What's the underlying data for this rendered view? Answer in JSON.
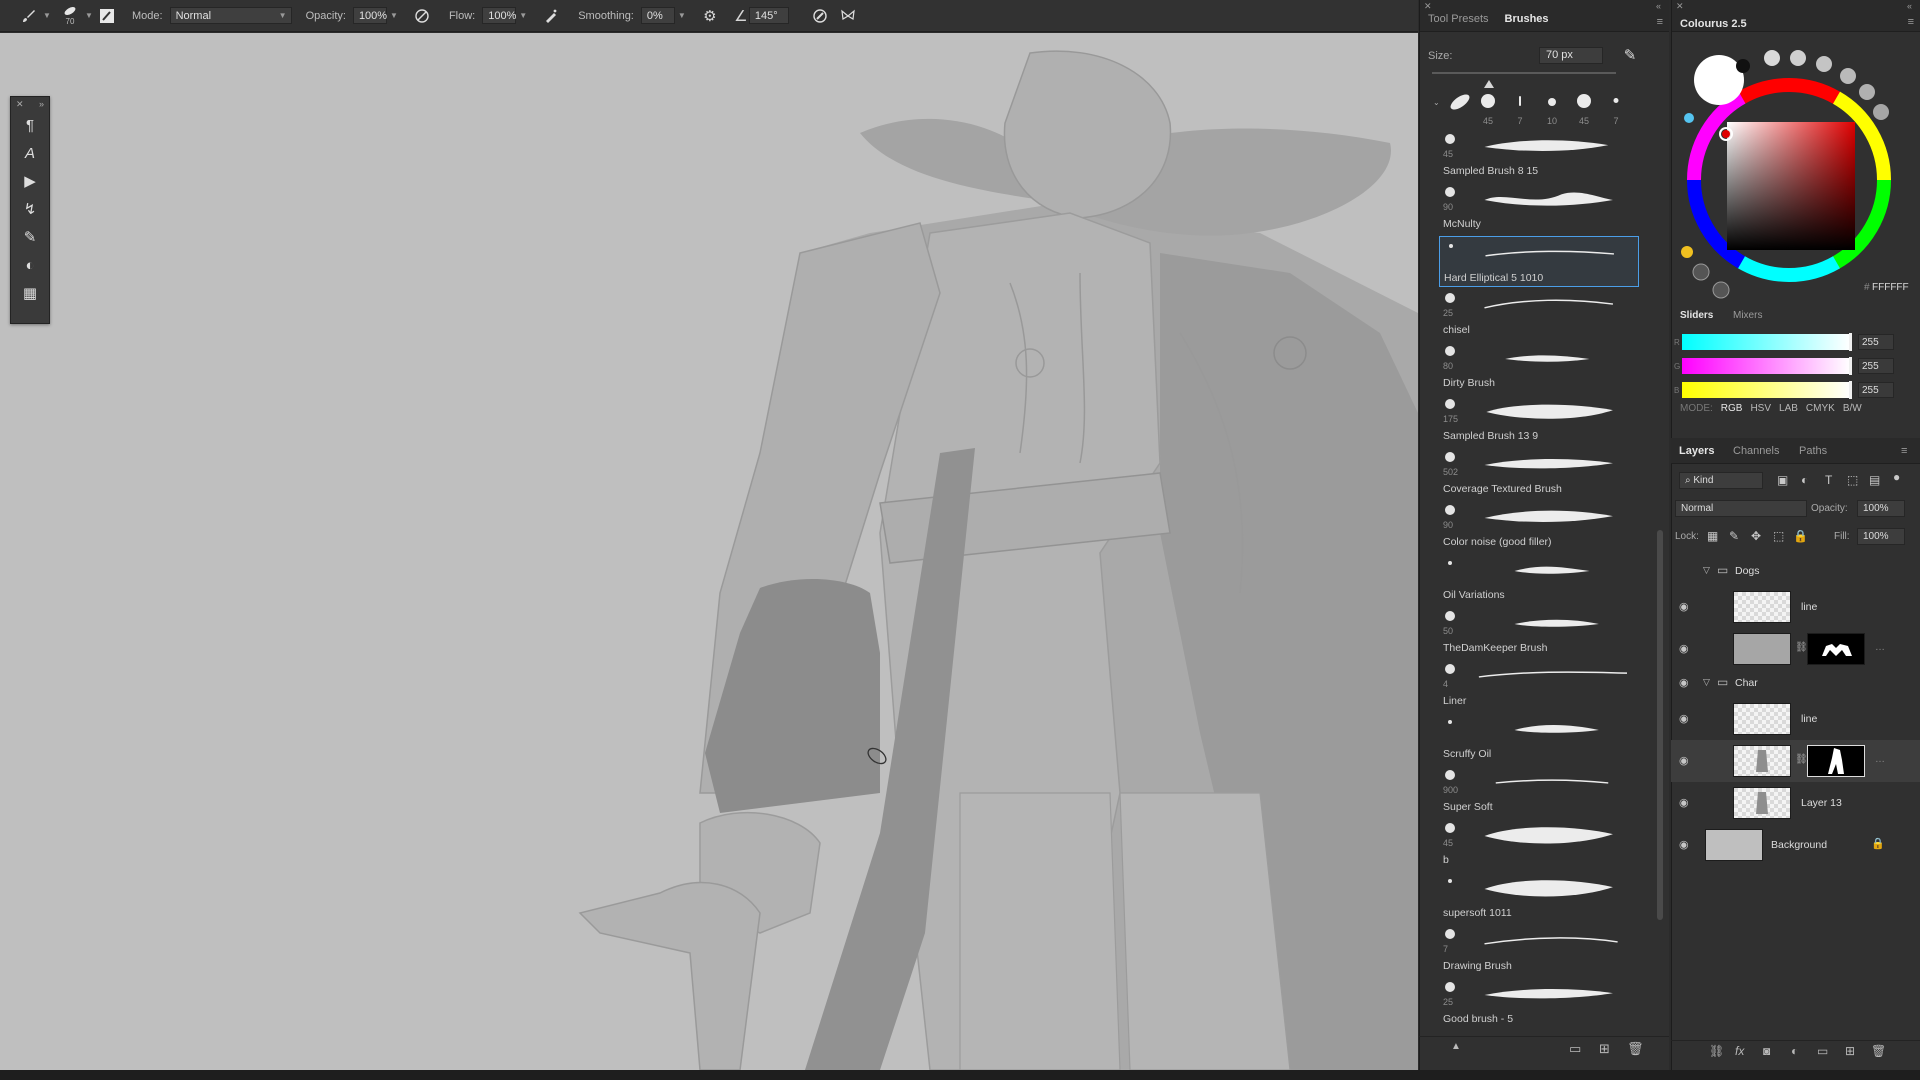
{
  "options_bar": {
    "brush_size_preview": "70",
    "mode_label": "Mode:",
    "mode_value": "Normal",
    "opacity_label": "Opacity:",
    "opacity_value": "100%",
    "flow_label": "Flow:",
    "flow_value": "100%",
    "smoothing_label": "Smoothing:",
    "smoothing_value": "0%",
    "angle_value": "145°"
  },
  "brushes_panel": {
    "tabs": [
      "Tool Presets",
      "Brushes"
    ],
    "active_tab": "Brushes",
    "size_label": "Size:",
    "size_value": "70 px",
    "recent_sizes": [
      "45",
      "7",
      "10",
      "45",
      "7"
    ],
    "brushes": [
      {
        "size": "45",
        "name": "Sampled Brush 8 15"
      },
      {
        "size": "90",
        "name": "McNulty"
      },
      {
        "size": "",
        "name": "Hard Elliptical 5 1010",
        "selected": true
      },
      {
        "size": "25",
        "name": "chisel"
      },
      {
        "size": "80",
        "name": "Dirty Brush"
      },
      {
        "size": "175",
        "name": "Sampled Brush 13 9"
      },
      {
        "size": "502",
        "name": "Coverage Textured Brush"
      },
      {
        "size": "90",
        "name": "Color noise (good filler)"
      },
      {
        "size": "",
        "name": "Oil Variations"
      },
      {
        "size": "50",
        "name": "TheDamKeeper Brush"
      },
      {
        "size": "4",
        "name": "Liner"
      },
      {
        "size": "",
        "name": "Scruffy Oil"
      },
      {
        "size": "900",
        "name": "Super Soft"
      },
      {
        "size": "45",
        "name": "b"
      },
      {
        "size": "",
        "name": "supersoft 1011"
      },
      {
        "size": "7",
        "name": "Drawing Brush"
      },
      {
        "size": "25",
        "name": "Good brush - 5"
      }
    ]
  },
  "colour_panel": {
    "title": "Colourus 2.5",
    "hex_value": "FFFFFF",
    "current_color": "#ffffff",
    "slider_tabs": [
      "Sliders",
      "Mixers"
    ],
    "active_slider_tab": "Sliders",
    "sliders": [
      {
        "letter": "R",
        "value": "255"
      },
      {
        "letter": "G",
        "value": "255"
      },
      {
        "letter": "B",
        "value": "255"
      }
    ],
    "mode_label": "MODE:",
    "modes": [
      "RGB",
      "HSV",
      "LAB",
      "CMYK",
      "B/W"
    ],
    "active_mode": "RGB"
  },
  "layers_panel": {
    "tabs": [
      "Layers",
      "Channels",
      "Paths"
    ],
    "active_tab": "Layers",
    "filter_kind": "Kind",
    "blend_mode": "Normal",
    "opacity_label": "Opacity:",
    "opacity_value": "100%",
    "lock_label": "Lock:",
    "fill_label": "Fill:",
    "fill_value": "100%",
    "layers": [
      {
        "type": "group",
        "name": "Dogs"
      },
      {
        "type": "layer",
        "name": "line"
      },
      {
        "type": "masked",
        "name": ""
      },
      {
        "type": "group",
        "name": "Char"
      },
      {
        "type": "layer",
        "name": "line"
      },
      {
        "type": "masked",
        "name": "",
        "selected": true
      },
      {
        "type": "layer",
        "name": "Layer 13"
      },
      {
        "type": "background",
        "name": "Background"
      }
    ]
  },
  "colors": {
    "canvas_bg": "#bfbfbf",
    "panel_bg": "#303030",
    "selection_accent": "#4b9ee8"
  }
}
